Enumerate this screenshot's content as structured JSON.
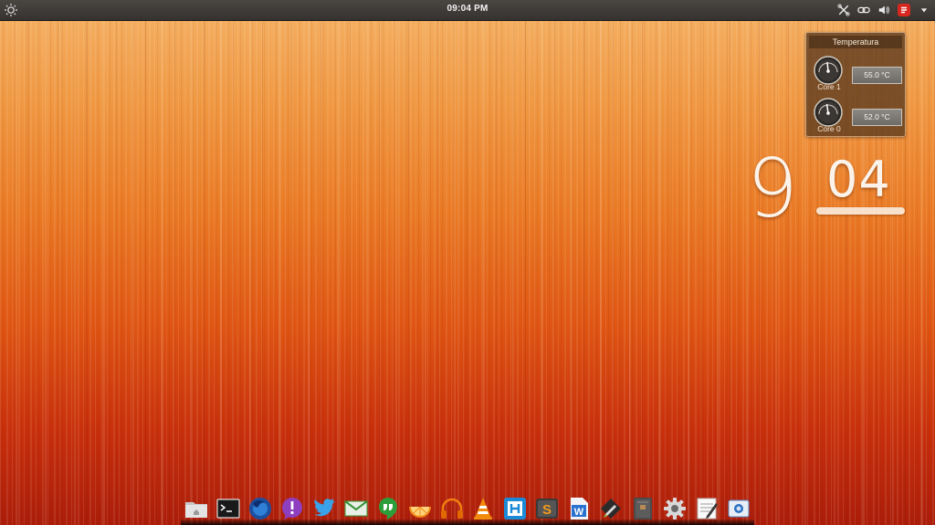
{
  "top_panel": {
    "clock": "09:04 PM",
    "left_icon": "gear-sun-icon",
    "indicators": [
      "network-tools-icon",
      "link-chain-icon",
      "volume-icon",
      "power-icon",
      "menu-caret-icon"
    ]
  },
  "temperature_widget": {
    "title": "Temperatura",
    "cores": [
      {
        "label": "Core 1",
        "value": "55.0 °C"
      },
      {
        "label": "Core 0",
        "value": "52.0 °C"
      }
    ]
  },
  "big_clock": {
    "hour": "9",
    "minutes": "04"
  },
  "dock": {
    "items": [
      "files-icon",
      "terminal-icon",
      "firefox-icon",
      "notification-icon",
      "twitter-icon",
      "mail-icon",
      "hangouts-icon",
      "slice-icon",
      "headphones-icon",
      "vlc-icon",
      "app-square-icon",
      "sublime-icon",
      "writer-icon",
      "pen-icon",
      "archive-icon",
      "settings-gear-icon",
      "text-editor-icon",
      "screenshot-icon"
    ]
  },
  "colors": {
    "panel": "#3d3936",
    "wallpaper_top": "#f5b266",
    "wallpaper_bottom": "#ab1d0a",
    "widget_bg": "#5a381e"
  }
}
